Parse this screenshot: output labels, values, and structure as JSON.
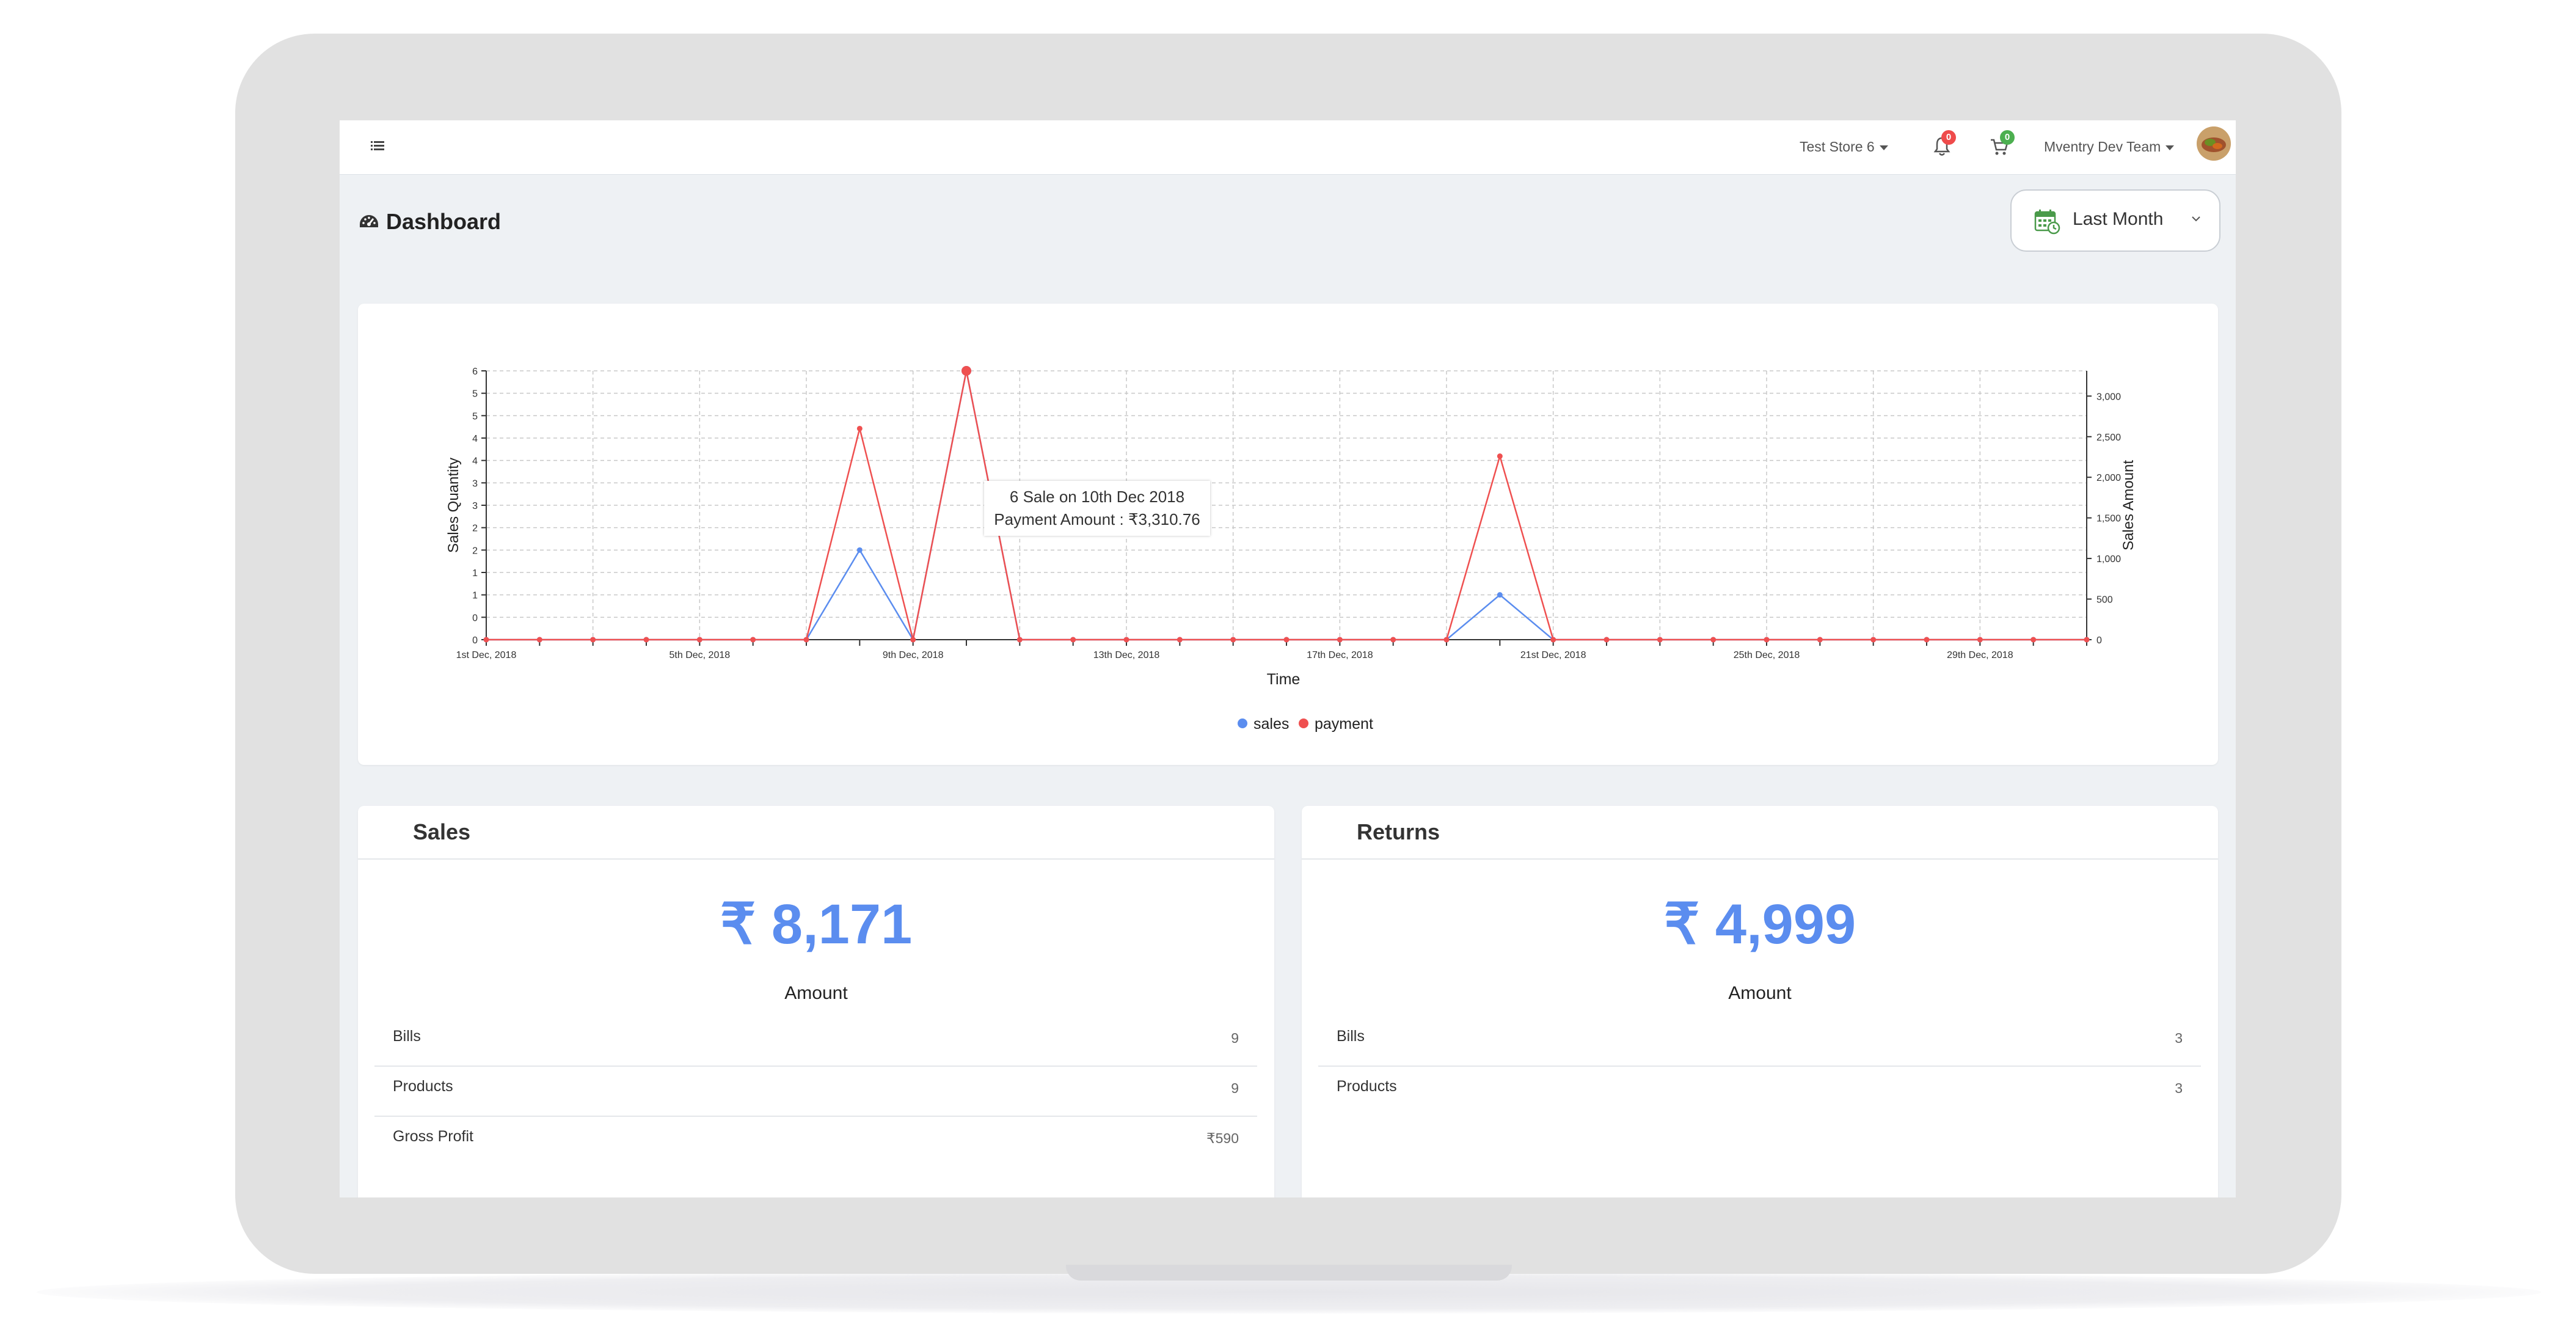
{
  "topbar": {
    "store": "Test Store 6",
    "notifications_count": "0",
    "cart_count": "0",
    "user": "Mventry Dev Team"
  },
  "page": {
    "title": "Dashboard",
    "range": "Last Month"
  },
  "chart_data": {
    "type": "line",
    "xlabel": "Time",
    "ylabel_left": "Sales Quantity",
    "ylabel_right": "Sales Amount",
    "x_ticks": [
      "1st Dec, 2018",
      "5th Dec, 2018",
      "9th Dec, 2018",
      "13th Dec, 2018",
      "17th Dec, 2018",
      "21st Dec, 2018",
      "25th Dec, 2018",
      "29th Dec, 2018"
    ],
    "y_left_ticks": [
      "0",
      "0",
      "1",
      "1",
      "2",
      "2",
      "3",
      "3",
      "4",
      "4",
      "5",
      "5",
      "6"
    ],
    "y_right_ticks": [
      "0",
      "500",
      "1,000",
      "1,500",
      "2,000",
      "2,500",
      "3,000"
    ],
    "ylim_left": [
      0,
      6
    ],
    "ylim_right": [
      0,
      3310.76
    ],
    "days": 31,
    "series": [
      {
        "name": "sales",
        "color": "#5b8def",
        "axis": "left",
        "values": [
          0,
          0,
          0,
          0,
          0,
          0,
          0,
          2,
          0,
          6,
          0,
          0,
          0,
          0,
          0,
          0,
          0,
          0,
          0,
          1,
          0,
          0,
          0,
          0,
          0,
          0,
          0,
          0,
          0,
          0,
          0
        ]
      },
      {
        "name": "payment",
        "color": "#ef5050",
        "axis": "right",
        "values": [
          0,
          0,
          0,
          0,
          0,
          0,
          0,
          2600,
          0,
          3310.76,
          0,
          0,
          0,
          0,
          0,
          0,
          0,
          0,
          0,
          2260,
          0,
          0,
          0,
          0,
          0,
          0,
          0,
          0,
          0,
          0,
          0
        ]
      }
    ],
    "legend": "bottom-center",
    "tooltip": {
      "line1": "6 Sale on 10th Dec 2018",
      "line2": "Payment Amount : ₹3,310.76"
    }
  },
  "sales": {
    "title": "Sales",
    "amount": "₹ 8,171",
    "amount_label": "Amount",
    "rows": [
      {
        "label": "Bills",
        "value": "9"
      },
      {
        "label": "Products",
        "value": "9"
      },
      {
        "label": "Gross Profit",
        "value": "₹590"
      }
    ]
  },
  "returns": {
    "title": "Returns",
    "amount": "₹ 4,999",
    "amount_label": "Amount",
    "rows": [
      {
        "label": "Bills",
        "value": "3"
      },
      {
        "label": "Products",
        "value": "3"
      }
    ]
  }
}
